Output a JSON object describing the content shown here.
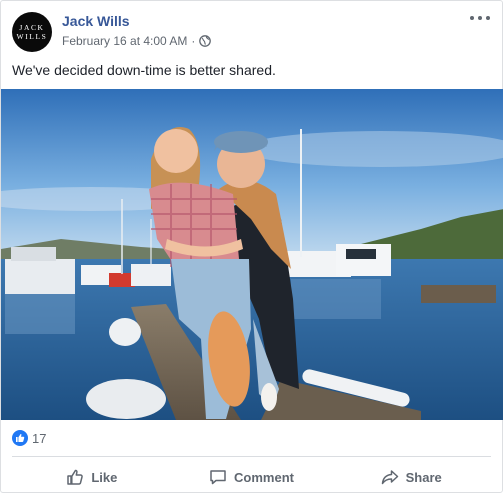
{
  "post": {
    "author": "Jack Wills",
    "avatar_text_line1": "JACK",
    "avatar_text_line2": "WILLS",
    "timestamp": "February 16 at 4:00 AM",
    "separator": "·",
    "privacy_icon": "globe-icon",
    "caption": "We've decided down-time is better shared.",
    "photo_description_icon": "photo"
  },
  "reactions": {
    "icon": "like-icon",
    "count": "17"
  },
  "actions": {
    "like_label": "Like",
    "comment_label": "Comment",
    "share_label": "Share"
  },
  "colors": {
    "link": "#385898",
    "like_blue": "#2078f4",
    "secondary_text": "#606770"
  }
}
